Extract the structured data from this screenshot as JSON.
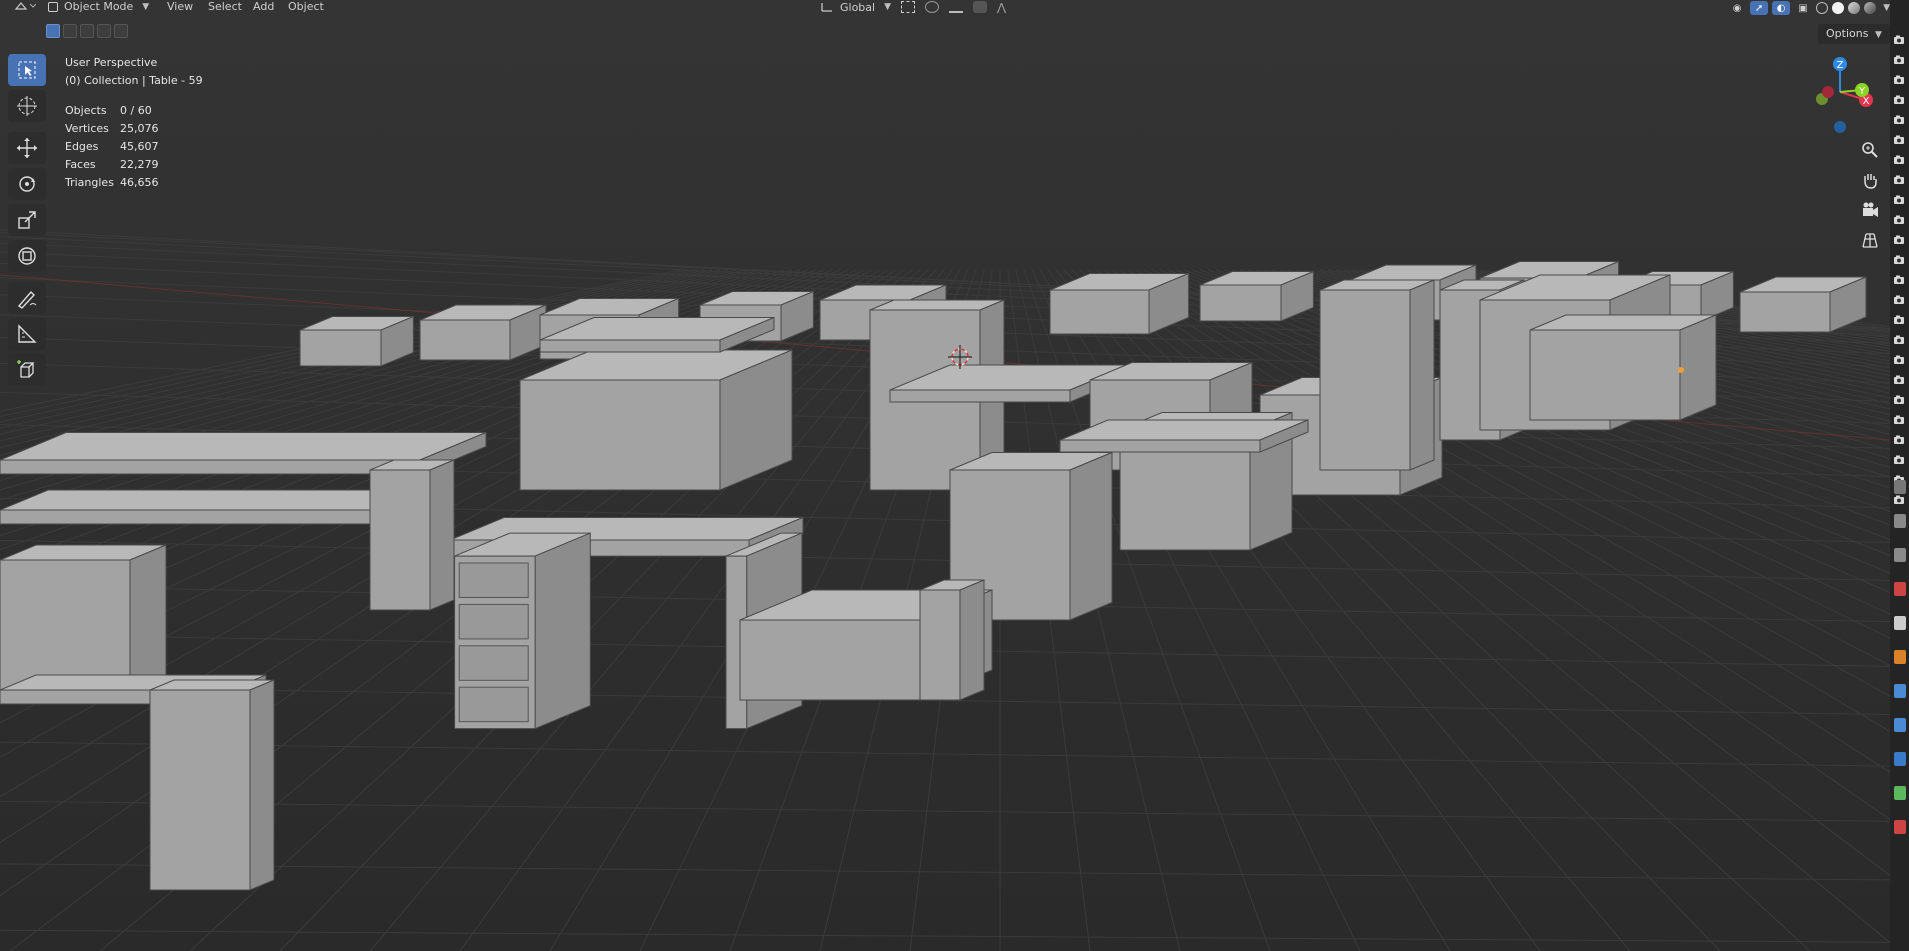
{
  "header": {
    "mode": "Object Mode",
    "menus": [
      "View",
      "Select",
      "Add",
      "Object"
    ],
    "transform_orientation": "Global",
    "options_label": "Options"
  },
  "overlay": {
    "view_name": "User Perspective",
    "collection_line": "(0) Collection | Table - 59",
    "stats": [
      {
        "label": "Objects",
        "value": "0 / 60"
      },
      {
        "label": "Vertices",
        "value": "25,076"
      },
      {
        "label": "Edges",
        "value": "45,607"
      },
      {
        "label": "Faces",
        "value": "22,279"
      },
      {
        "label": "Triangles",
        "value": "46,656"
      }
    ]
  },
  "gizmo": {
    "x_label": "X",
    "y_label": "Y",
    "z_label": "Z",
    "x_color": "#e3364e",
    "y_color": "#8bd424",
    "z_color": "#2f8ae6"
  },
  "toolbar": {
    "tools": [
      "select-box-icon",
      "cursor-icon",
      "move-icon",
      "rotate-icon",
      "scale-icon",
      "transform-icon",
      "annotate-icon",
      "measure-icon",
      "add-cube-icon"
    ]
  },
  "colors": {
    "accent": "#4772b3",
    "viewport_bg": "#2f2f2f",
    "mesh": "#9a9a9a"
  }
}
